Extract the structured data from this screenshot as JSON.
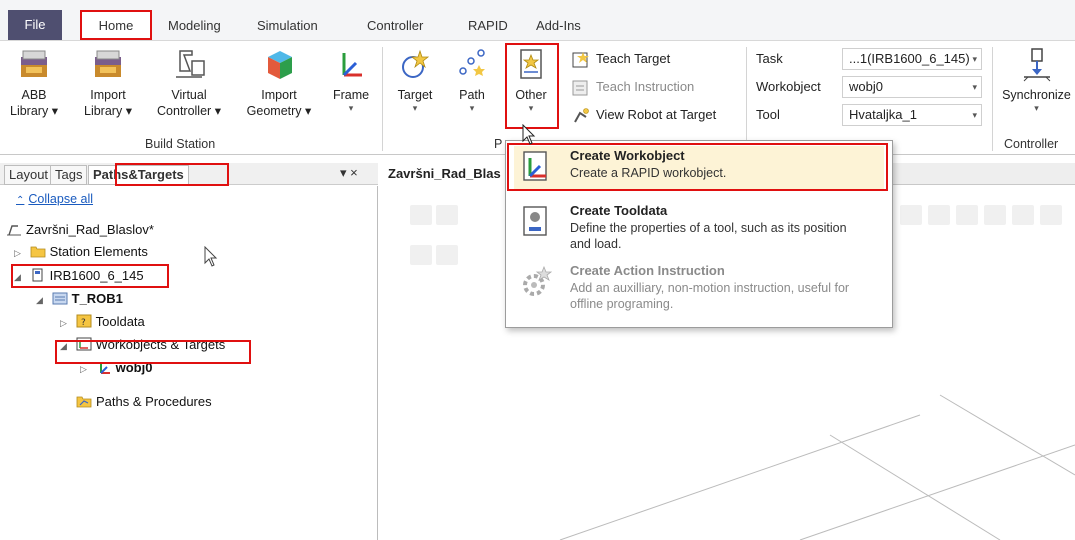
{
  "menu_tabs": {
    "file": "File",
    "home": "Home",
    "modeling": "Modeling",
    "simulation": "Simulation",
    "controller": "Controller",
    "rapid": "RAPID",
    "addins": "Add-Ins"
  },
  "ribbon": {
    "abb_library": [
      "ABB",
      "Library"
    ],
    "import_library": [
      "Import",
      "Library"
    ],
    "virtual_controller": [
      "Virtual",
      "Controller"
    ],
    "import_geometry": [
      "Import",
      "Geometry"
    ],
    "frame": "Frame",
    "build_station_group": "Build Station",
    "target": "Target",
    "path": "Path",
    "other": "Other",
    "path_group_partial": "P",
    "teach_target": "Teach Target",
    "teach_instruction": "Teach Instruction",
    "view_robot_at_target": "View Robot at Target",
    "task_label": "Task",
    "task_value": "...1(IRB1600_6_145)",
    "workobject_label": "Workobject",
    "workobject_value": "wobj0",
    "tool_label": "Tool",
    "tool_value": "Hvataljka_1",
    "synchronize": "Synchronize",
    "controller_group": "Controller",
    "dropdown_arrow": "▾"
  },
  "panel": {
    "tabs": [
      "Layout",
      "Tags",
      "Paths&Targets"
    ],
    "pin": "▾ ×",
    "collapse_all": "Collapse all"
  },
  "tree": {
    "station": "Završni_Rad_Blaslov*",
    "station_elements": "Station Elements",
    "robot": "IRB1600_6_145",
    "task": "T_ROB1",
    "tooldata": "Tooldata",
    "workobjects_targets": "Workobjects & Targets",
    "wobj0": "wobj0",
    "paths_procedures": "Paths & Procedures"
  },
  "document": {
    "tab_title": "Završni_Rad_Blas"
  },
  "menu": {
    "create_workobject": {
      "title": "Create Workobject",
      "desc": "Create a RAPID workobject."
    },
    "create_tooldata": {
      "title": "Create Tooldata",
      "desc": "Define the properties of a tool, such as its position and load."
    },
    "create_action_instruction": {
      "title": "Create Action Instruction",
      "desc": "Add an auxilliary, non-motion instruction, useful for offline programing."
    }
  },
  "colors": {
    "highlight": "#e01010",
    "file_tab": "#4f4f70",
    "link": "#1a5bbf"
  }
}
